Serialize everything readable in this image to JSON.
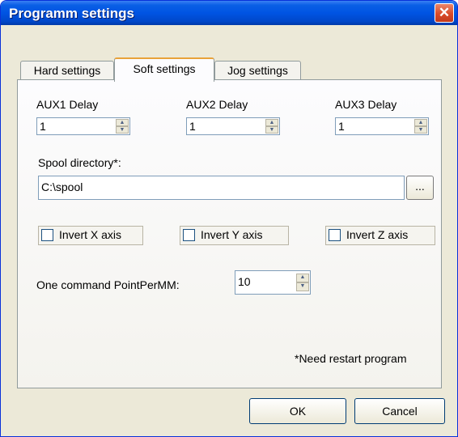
{
  "window": {
    "title": "Programm settings",
    "close_glyph": "✕"
  },
  "tabs": [
    {
      "label": "Hard settings"
    },
    {
      "label": "Soft settings"
    },
    {
      "label": "Jog settings"
    }
  ],
  "active_tab": "Soft settings",
  "aux": [
    {
      "label": "AUX1 Delay",
      "value": "1"
    },
    {
      "label": "AUX2 Delay",
      "value": "1"
    },
    {
      "label": "AUX3 Delay",
      "value": "1"
    }
  ],
  "spool": {
    "label": "Spool directory*:",
    "value": "C:\\spool",
    "browse_label": "..."
  },
  "checkboxes": [
    {
      "label": "Invert X axis",
      "checked": false
    },
    {
      "label": "Invert Y axis",
      "checked": false
    },
    {
      "label": "Invert Z axis",
      "checked": false
    }
  ],
  "points": {
    "label": "One command PointPerMM:",
    "value": "10"
  },
  "note": "*Need restart program",
  "buttons": {
    "ok": "OK",
    "cancel": "Cancel"
  },
  "spin_glyphs": {
    "up": "▲",
    "down": "▼"
  },
  "colors": {
    "titlebar": "#0054e3",
    "face": "#ece9d8",
    "close": "#d94b2a"
  }
}
